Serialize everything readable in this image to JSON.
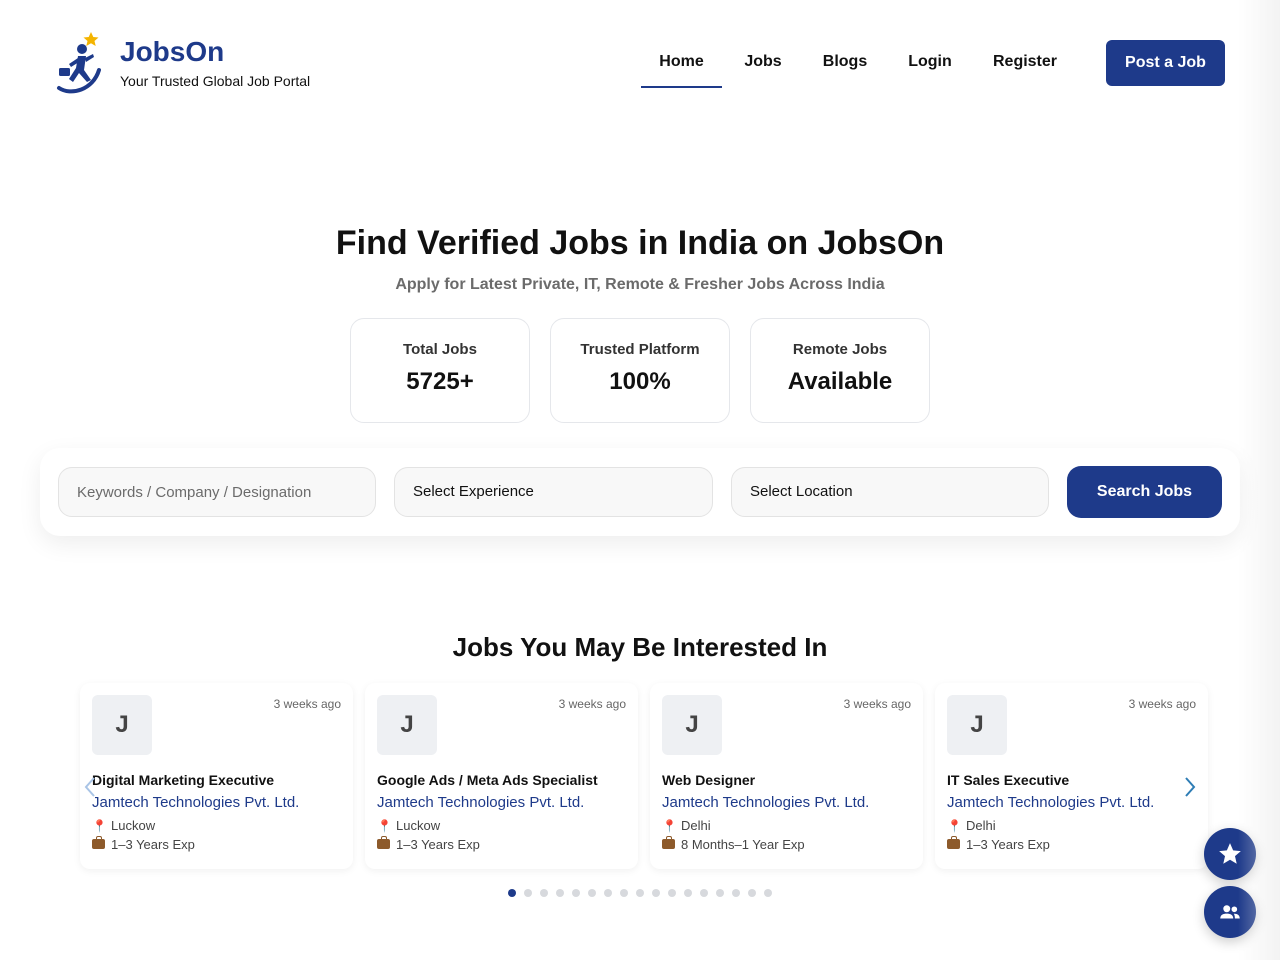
{
  "brand": {
    "name": "JobsOn",
    "tagline": "Your Trusted Global Job Portal"
  },
  "nav": {
    "items": [
      {
        "label": "Home",
        "active": true
      },
      {
        "label": "Jobs",
        "active": false
      },
      {
        "label": "Blogs",
        "active": false
      },
      {
        "label": "Login",
        "active": false
      },
      {
        "label": "Register",
        "active": false
      }
    ],
    "cta_label": "Post a Job"
  },
  "hero": {
    "title": "Find Verified Jobs in India on JobsOn",
    "subtitle": "Apply for Latest Private, IT, Remote & Fresher Jobs Across India",
    "stats": [
      {
        "label": "Total Jobs",
        "value": "5725+"
      },
      {
        "label": "Trusted Platform",
        "value": "100%"
      },
      {
        "label": "Remote Jobs",
        "value": "Available"
      }
    ]
  },
  "search": {
    "keyword_placeholder": "Keywords / Company / Designation",
    "experience_selected": "Select Experience",
    "location_selected": "Select Location",
    "button_label": "Search Jobs"
  },
  "jobs_section": {
    "title": "Jobs You May Be Interested In",
    "jobs": [
      {
        "initial": "J",
        "posted": "3 weeks ago",
        "title": "Digital Marketing Executive",
        "company": "Jamtech Technologies Pvt. Ltd.",
        "location": "Luckow",
        "experience": "1–3 Years Exp"
      },
      {
        "initial": "J",
        "posted": "3 weeks ago",
        "title": "Google Ads / Meta Ads Specialist",
        "company": "Jamtech Technologies Pvt. Ltd.",
        "location": "Luckow",
        "experience": "1–3 Years Exp"
      },
      {
        "initial": "J",
        "posted": "3 weeks ago",
        "title": "Web Designer",
        "company": "Jamtech Technologies Pvt. Ltd.",
        "location": "Delhi",
        "experience": "8 Months–1 Year Exp"
      },
      {
        "initial": "J",
        "posted": "3 weeks ago",
        "title": "IT Sales Executive",
        "company": "Jamtech Technologies Pvt. Ltd.",
        "location": "Delhi",
        "experience": "1–3 Years Exp"
      }
    ],
    "carousel": {
      "page_count": 17,
      "active_index": 0
    }
  },
  "icons": {
    "logo": "running-man-star-logo",
    "prev": "chevron-left-icon",
    "next": "chevron-right-icon",
    "location": "pin-icon",
    "experience": "briefcase-icon",
    "fab_top": "star-icon",
    "fab_bottom": "users-icon"
  },
  "colors": {
    "primary": "#1e3a8a",
    "accent_star": "#f4b400",
    "pin": "#d32f2f"
  }
}
